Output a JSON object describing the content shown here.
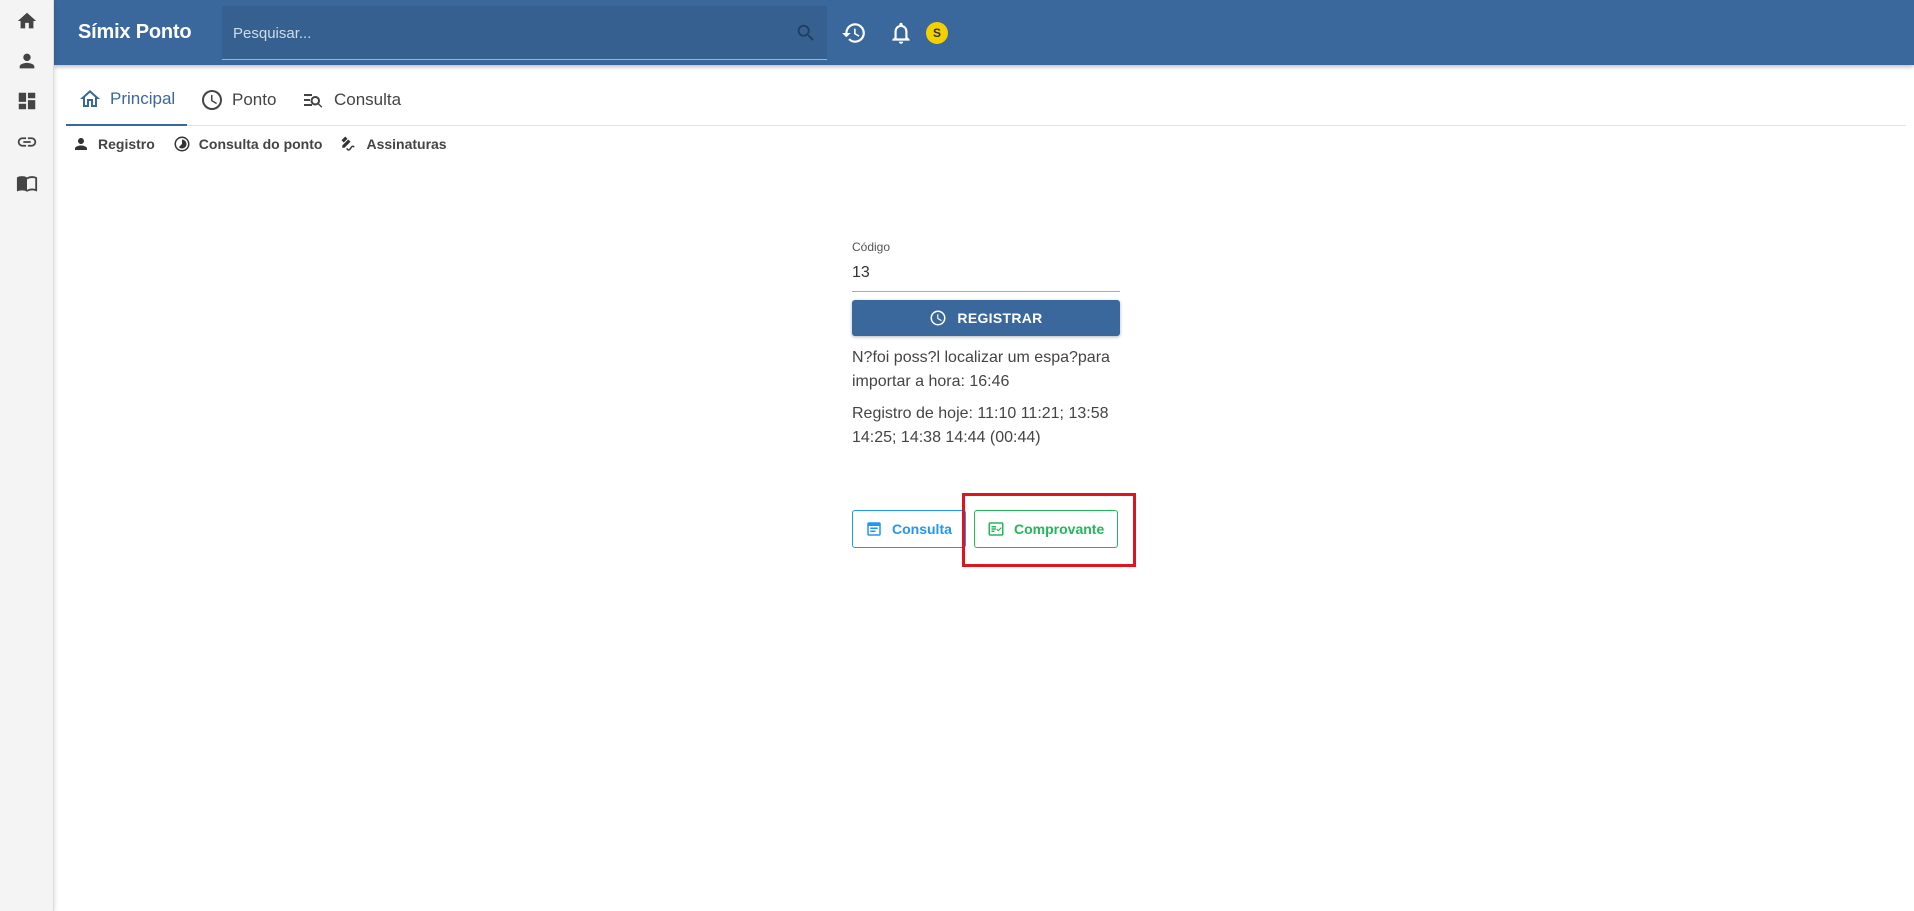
{
  "app": {
    "title": "Símix Ponto"
  },
  "rail": {
    "items": [
      {
        "icon": "home-icon"
      },
      {
        "icon": "person-icon"
      },
      {
        "icon": "dashboard-icon"
      },
      {
        "icon": "link-icon"
      },
      {
        "icon": "book-icon"
      }
    ]
  },
  "search": {
    "placeholder": "Pesquisar...",
    "value": ""
  },
  "header": {
    "avatar_letter": "S",
    "avatar_color": "#f5d000",
    "brand_color": "#3b689c"
  },
  "tabs": [
    {
      "label": "Principal",
      "icon": "home-outline-icon",
      "active": true
    },
    {
      "label": "Ponto",
      "icon": "clock-icon",
      "active": false
    },
    {
      "label": "Consulta",
      "icon": "search-list-icon",
      "active": false
    }
  ],
  "subnav": [
    {
      "label": "Registro",
      "icon": "person-icon"
    },
    {
      "label": "Consulta do ponto",
      "icon": "timelapse-icon"
    },
    {
      "label": "Assinaturas",
      "icon": "signature-icon"
    }
  ],
  "form": {
    "code_label": "Código",
    "code_value": "13",
    "register_label": "REGISTRAR",
    "message_time": "N?foi poss?l localizar um espa?para importar a hora: 16:46",
    "message_today": "Registro de hoje: 11:10 11:21; 13:58 14:25; 14:38 14:44 (00:44)"
  },
  "actions": {
    "consulta_label": "Consulta",
    "comprovante_label": "Comprovante",
    "consulta_color": "#2196f3",
    "comprovante_color": "#21b85a",
    "highlight_color": "#e0141e"
  }
}
